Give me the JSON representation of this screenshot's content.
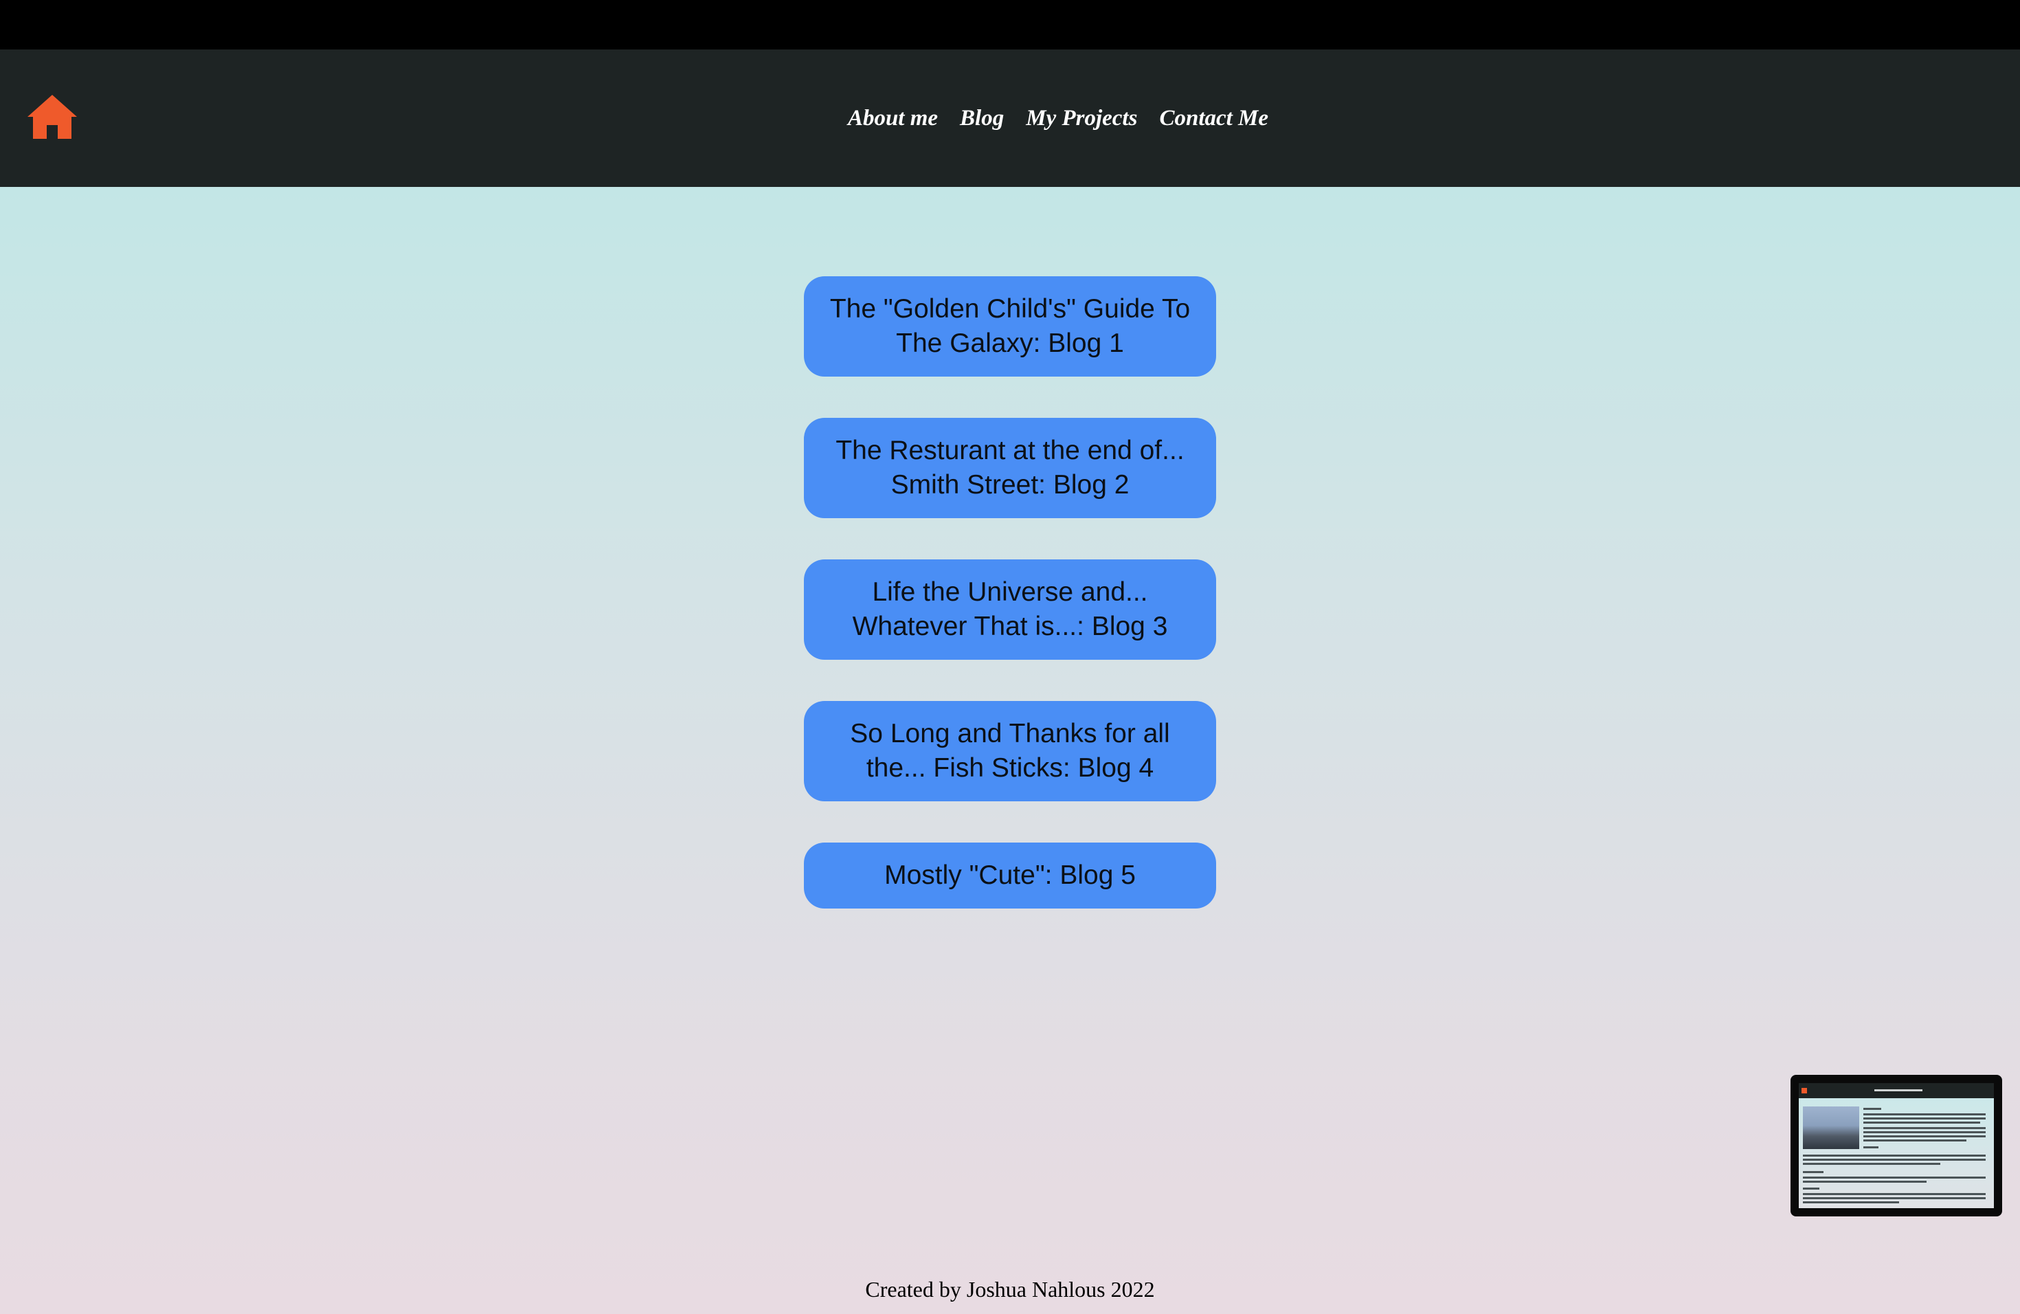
{
  "nav": {
    "links": [
      "About me",
      "Blog",
      "My Projects",
      "Contact Me"
    ]
  },
  "blogs": [
    "The \"Golden Child's\" Guide To The Galaxy: Blog 1",
    "The Resturant at the end of... Smith Street: Blog 2",
    "Life the Universe and... Whatever That is...: Blog 3",
    "So Long and Thanks for all the... Fish Sticks: Blog 4",
    "Mostly \"Cute\": Blog 5"
  ],
  "footer": {
    "text": "Created by Joshua Nahlous 2022"
  },
  "icons": {
    "home": "home-icon"
  },
  "colors": {
    "navbar": "#1e2424",
    "home_icon": "#ef5a2b",
    "button": "#4a8ef5",
    "gradient_top": "#bbe8e6",
    "gradient_bottom": "#e8dbe2"
  }
}
